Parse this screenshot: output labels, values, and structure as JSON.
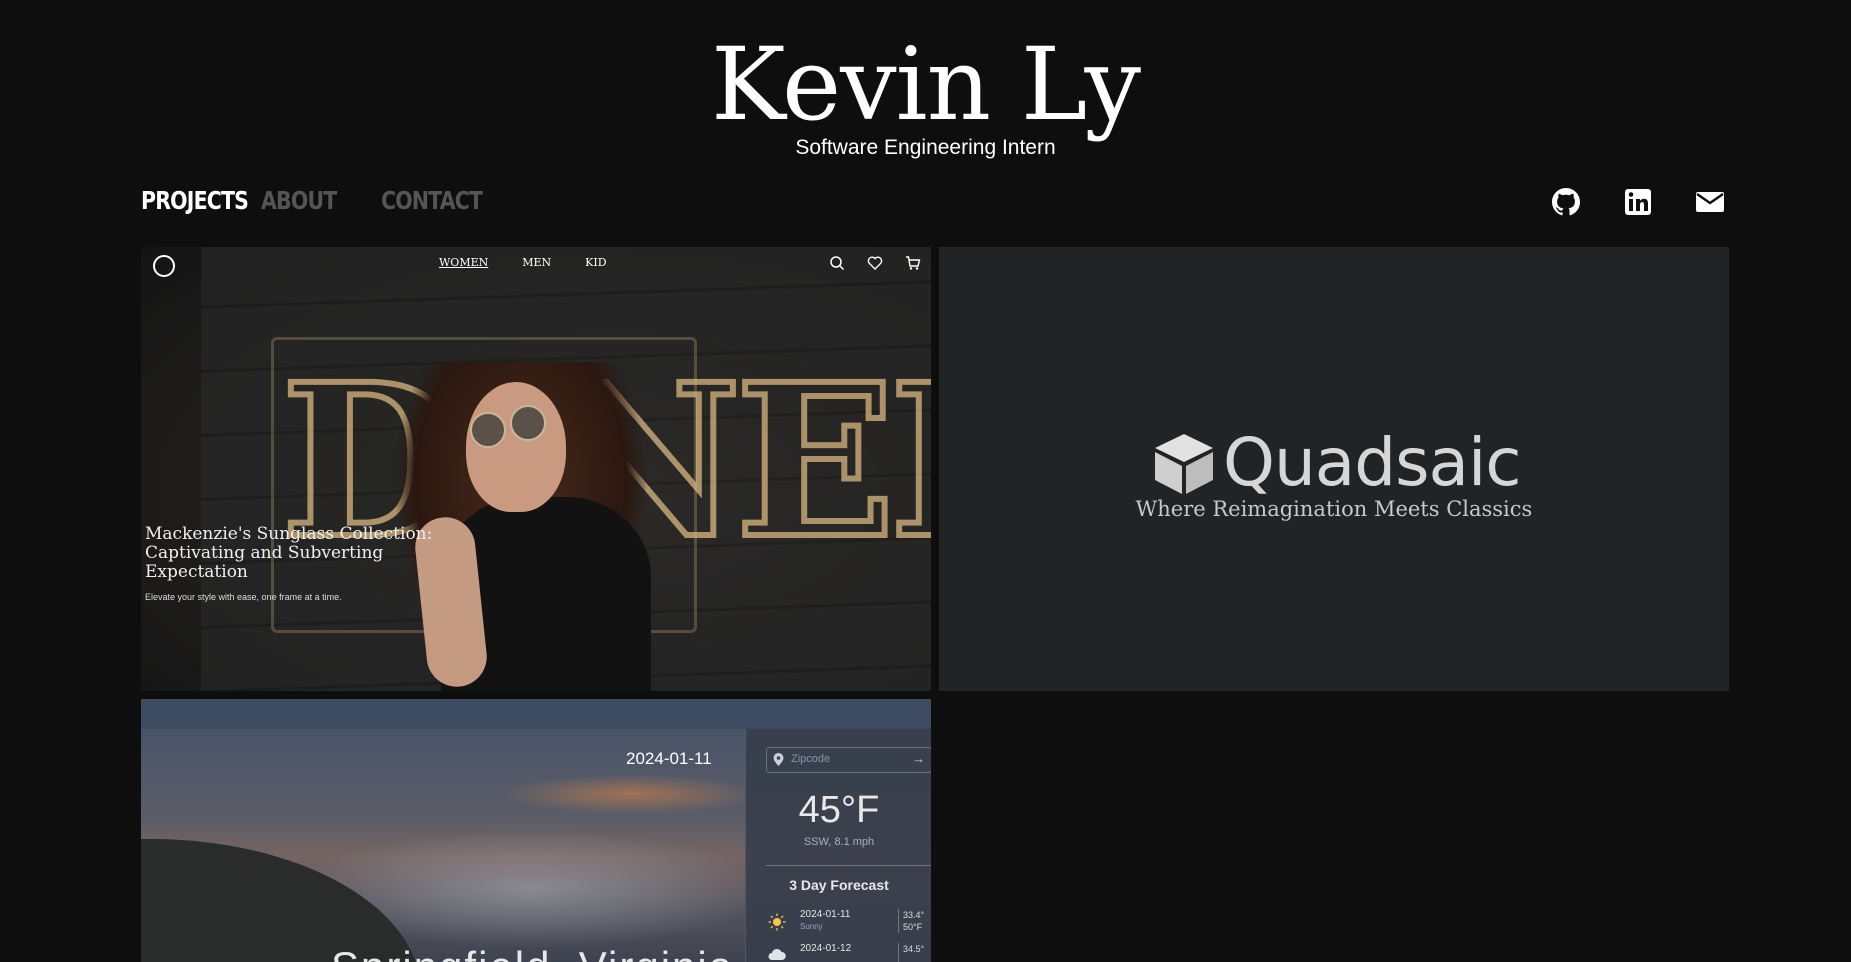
{
  "header": {
    "title": "Kevin Ly",
    "subtitle": "Software Engineering Intern"
  },
  "nav": {
    "items": [
      {
        "label": "PROJECTS",
        "active": true
      },
      {
        "label": "ABOUT",
        "active": false
      },
      {
        "label": "CONTACT",
        "active": false
      }
    ]
  },
  "social": {
    "icons": [
      "github-icon",
      "linkedin-icon",
      "mail-icon"
    ]
  },
  "projects": {
    "sunglass": {
      "menu": [
        "WOMEN",
        "MEN",
        "KID"
      ],
      "title": "Mackenzie's Sunglass Collection: Captivating and Subverting Expectation",
      "subtitle": "Elevate your style with ease, one frame at a time."
    },
    "quadsaic": {
      "name": "Quadsaic",
      "tagline": "Where Reimagination Meets Classics"
    },
    "weather": {
      "date": "2024-01-11",
      "city": "Springfield, Virginia",
      "zip_placeholder": "Zipcode",
      "temperature": "45°F",
      "wind": "SSW, 8.1 mph",
      "forecast_title": "3 Day Forecast",
      "forecast": [
        {
          "date": "2024-01-11",
          "condition": "Sunny",
          "hi": "33.4°",
          "lo": "50°F"
        },
        {
          "date": "2024-01-12",
          "condition": "",
          "hi": "34.5°",
          "lo": ""
        }
      ]
    }
  },
  "colors": {
    "background": "#0e0e0e",
    "nav_inactive": "#555555",
    "quadsaic_bg": "#212325"
  }
}
